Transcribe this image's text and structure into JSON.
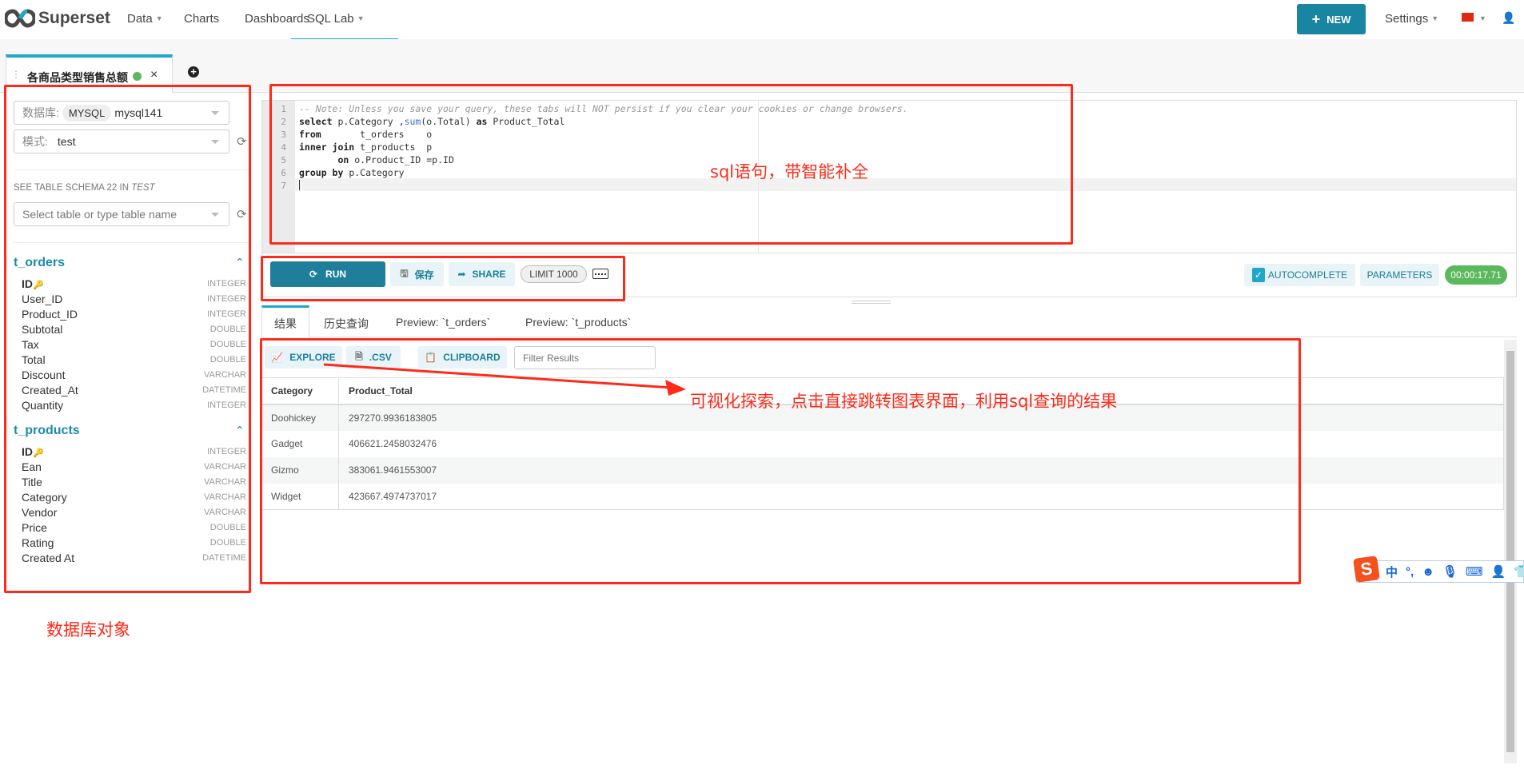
{
  "nav": {
    "brand": "Superset",
    "items": [
      {
        "label": "Data",
        "caret": true
      },
      {
        "label": "Charts"
      },
      {
        "label": "Dashboards"
      },
      {
        "label": "SQL Lab",
        "caret": true,
        "active": true
      }
    ],
    "new_label": "NEW",
    "settings": "Settings"
  },
  "query_tab": {
    "title": "各商品类型销售总额",
    "status_color": "#5cb85c",
    "close": "×"
  },
  "sidebar": {
    "db_label": "数据库:",
    "db_backend": "MYSQL",
    "db_name": "mysql141",
    "schema_label": "模式:",
    "schema": "test",
    "schema_info": "SEE TABLE SCHEMA 22 IN ",
    "schema_info_em": "TEST",
    "table_placeholder": "Select table or type table name",
    "tables": [
      {
        "name": "t_orders",
        "columns": [
          [
            "ID",
            "INTEGER",
            true
          ],
          [
            "User_ID",
            "INTEGER"
          ],
          [
            "Product_ID",
            "INTEGER"
          ],
          [
            "Subtotal",
            "DOUBLE"
          ],
          [
            "Tax",
            "DOUBLE"
          ],
          [
            "Total",
            "DOUBLE"
          ],
          [
            "Discount",
            "VARCHAR"
          ],
          [
            "Created_At",
            "DATETIME"
          ],
          [
            "Quantity",
            "INTEGER"
          ]
        ]
      },
      {
        "name": "t_products",
        "columns": [
          [
            "ID",
            "INTEGER",
            true
          ],
          [
            "Ean",
            "VARCHAR"
          ],
          [
            "Title",
            "VARCHAR"
          ],
          [
            "Category",
            "VARCHAR"
          ],
          [
            "Vendor",
            "VARCHAR"
          ],
          [
            "Price",
            "DOUBLE"
          ],
          [
            "Rating",
            "DOUBLE"
          ],
          [
            "Created At",
            "DATETIME"
          ]
        ]
      }
    ]
  },
  "editor": {
    "lines": [
      [
        [
          "-- Note: Unless you save your query, these tabs will NOT persist if you clear your cookies or change browsers.",
          "cm"
        ]
      ],
      [
        [
          "select",
          "kw"
        ],
        [
          " p.Category ,",
          ""
        ],
        [
          "sum",
          "fn"
        ],
        [
          "(o.Total) ",
          ""
        ],
        [
          "as",
          "kw"
        ],
        [
          " Product_Total",
          ""
        ]
      ],
      [
        [
          "from",
          "kw"
        ],
        [
          "       t_orders    o",
          ""
        ]
      ],
      [
        [
          "inner join",
          "kw"
        ],
        [
          " t_products  p",
          ""
        ]
      ],
      [
        [
          "       ",
          ""
        ],
        [
          "on",
          "kw"
        ],
        [
          " o.Product_ID =p.ID",
          ""
        ]
      ],
      [
        [
          "group by",
          "kw"
        ],
        [
          " p.Category",
          ""
        ]
      ],
      []
    ]
  },
  "toolbar": {
    "run": "RUN",
    "save": "保存",
    "share": "SHARE",
    "limit": "LIMIT 1000",
    "autocomplete": "AUTOCOMPLETE",
    "autocomplete_checked": true,
    "parameters": "PARAMETERS",
    "timer": "00:00:17.71",
    "timer_color": "#5cb85c"
  },
  "result_tabs": [
    "结果",
    "历史查询",
    "Preview: `t_orders`",
    "Preview: `t_products`"
  ],
  "results": {
    "explore": "EXPLORE",
    "csv": ".CSV",
    "clipboard": "CLIPBOARD",
    "filter_placeholder": "Filter Results",
    "columns": [
      "Category",
      "Product_Total"
    ],
    "rows": [
      [
        "Doohickey",
        "297270.9936183805"
      ],
      [
        "Gadget",
        "406621.2458032476"
      ],
      [
        "Gizmo",
        "383061.9461553007"
      ],
      [
        "Widget",
        "423667.4974737017"
      ]
    ]
  },
  "annotations": {
    "editor": "sql语句，带智能补全",
    "sidebar": "数据库对象",
    "explore": "可视化探索，点击直接跳转图表界面，利用sql查询的结果",
    "color": "#ff2a1a"
  },
  "ime": {
    "lang": "中",
    "punct": "°,"
  },
  "colors": {
    "accent": "#20a7c9",
    "primary_button": "#1a85a0",
    "table_title": "#1b8ba8"
  }
}
